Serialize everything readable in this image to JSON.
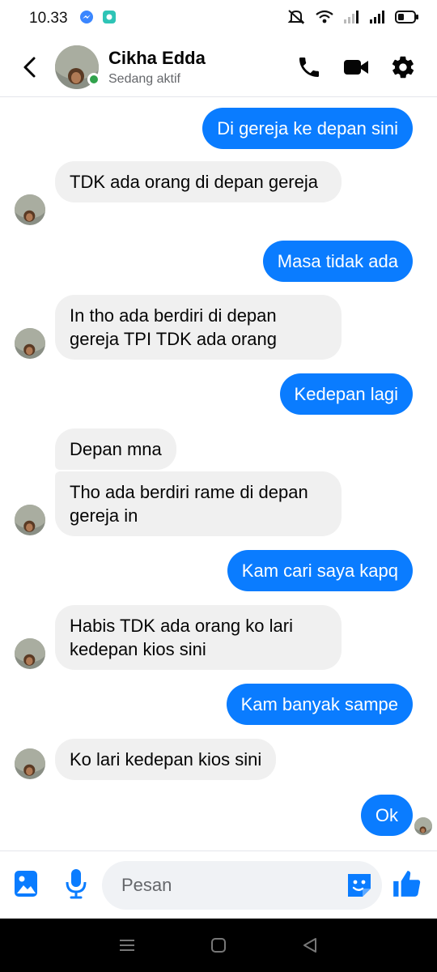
{
  "status_bar": {
    "time": "10.33",
    "left_icons": [
      "messenger-notification-icon",
      "app-notification-icon"
    ],
    "right_icons": [
      "mute-icon",
      "wifi-icon",
      "signal-icon",
      "signal-icon-2",
      "battery-icon"
    ]
  },
  "header": {
    "contact_name": "Cikha Edda",
    "contact_status": "Sedang aktif",
    "actions": [
      "phone-icon",
      "video-icon",
      "settings-icon"
    ]
  },
  "messages": [
    {
      "side": "out",
      "text": "Di gereja ke depan sini"
    },
    {
      "side": "in",
      "text": "TDK ada orang di depan gereja"
    },
    {
      "side": "out",
      "text": "Masa tidak ada"
    },
    {
      "side": "in",
      "text": "In tho ada berdiri di depan gereja TPI TDK ada orang"
    },
    {
      "side": "out",
      "text": "Kedepan lagi"
    },
    {
      "side": "in",
      "text": "Depan mna"
    },
    {
      "side": "in",
      "text": "Tho ada berdiri rame di depan gereja in"
    },
    {
      "side": "out",
      "text": "Kam cari saya kapq"
    },
    {
      "side": "in",
      "text": "Habis TDK ada orang ko lari kedepan kios sini"
    },
    {
      "side": "out",
      "text": "Kam banyak sampe"
    },
    {
      "side": "in",
      "text": "Ko lari kedepan kios sini"
    },
    {
      "side": "out",
      "text": "Ok"
    }
  ],
  "composer": {
    "placeholder": "Pesan",
    "buttons": [
      "gallery-icon",
      "microphone-icon",
      "sticker-icon",
      "thumbs-up-icon"
    ]
  },
  "colors": {
    "accent": "#0a7cff",
    "incoming_bubble": "#f0f0f0",
    "online": "#31a24c"
  }
}
